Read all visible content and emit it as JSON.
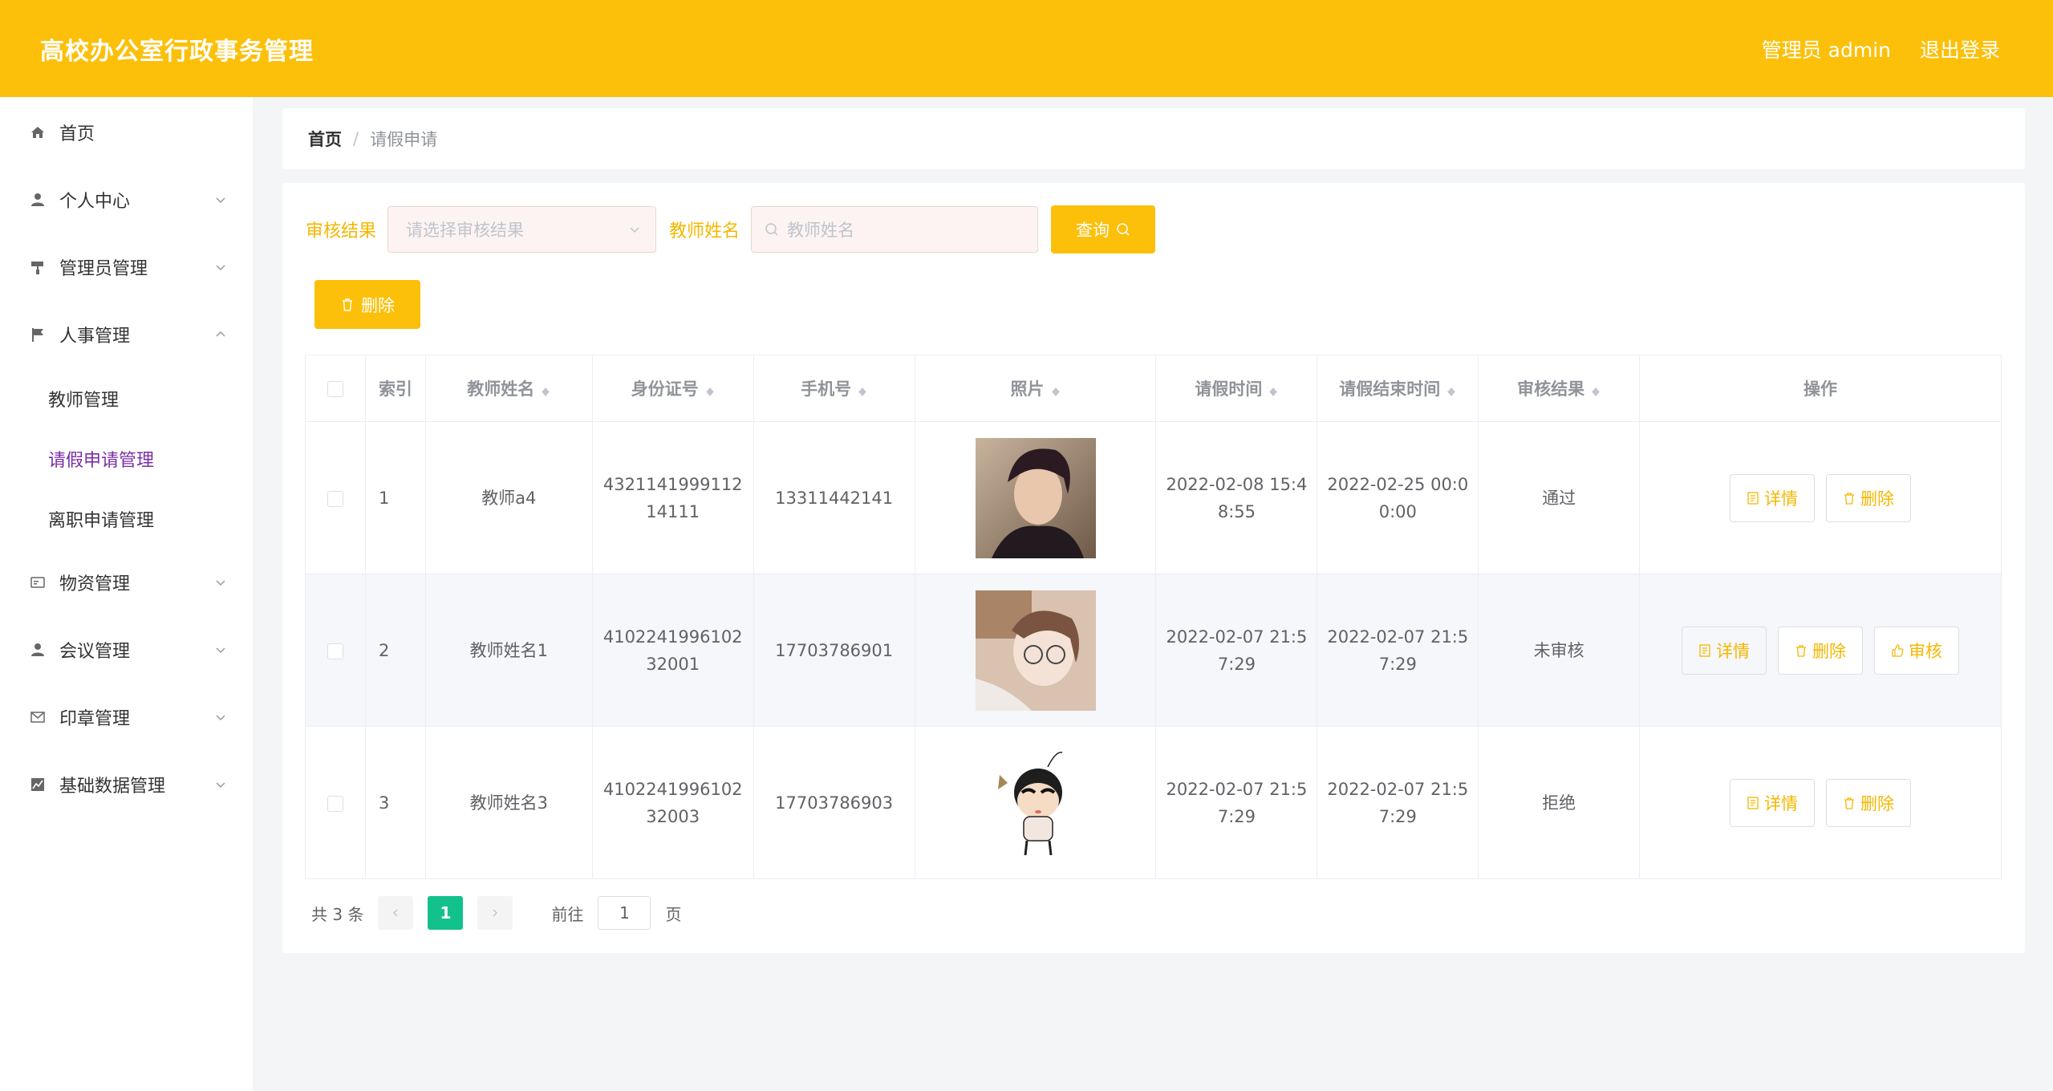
{
  "header": {
    "title": "高校办公室行政事务管理",
    "user": "管理员 admin",
    "logout": "退出登录"
  },
  "sidebar": {
    "items": [
      {
        "label": "首页",
        "icon": "home-icon"
      },
      {
        "label": "个人中心",
        "icon": "user-icon"
      },
      {
        "label": "管理员管理",
        "icon": "paint-roller-icon"
      },
      {
        "label": "人事管理",
        "icon": "flag-icon"
      },
      {
        "label": "物资管理",
        "icon": "id-card-icon"
      },
      {
        "label": "会议管理",
        "icon": "user-icon"
      },
      {
        "label": "印章管理",
        "icon": "mail-icon"
      },
      {
        "label": "基础数据管理",
        "icon": "chart-icon"
      }
    ],
    "sub_items": [
      {
        "label": "教师管理"
      },
      {
        "label": "请假申请管理"
      },
      {
        "label": "离职申请管理"
      }
    ]
  },
  "breadcrumb": {
    "home": "首页",
    "sep": "/",
    "current": "请假申请"
  },
  "filter": {
    "status_label": "审核结果",
    "status_placeholder": "请选择审核结果",
    "name_label": "教师姓名",
    "name_placeholder": "教师姓名",
    "query_button": "查询",
    "delete_button": "删除"
  },
  "table": {
    "columns": [
      "索引",
      "教师姓名",
      "身份证号",
      "手机号",
      "照片",
      "请假时间",
      "请假结束时间",
      "审核结果",
      "操作"
    ],
    "rows": [
      {
        "index": "1",
        "name": "教师a4",
        "id_line1": "4321141999112",
        "id_line2": "14111",
        "phone": "13311442141",
        "start_line1": "2022-02-08 15:4",
        "start_line2": "8:55",
        "end_line1": "2022-02-25 00:0",
        "end_line2": "0:00",
        "status": "通过",
        "detail": "详情",
        "delete": "删除"
      },
      {
        "index": "2",
        "name": "教师姓名1",
        "id_line1": "4102241996102",
        "id_line2": "32001",
        "phone": "17703786901",
        "start_line1": "2022-02-07 21:5",
        "start_line2": "7:29",
        "end_line1": "2022-02-07 21:5",
        "end_line2": "7:29",
        "status": "未审核",
        "detail": "详情",
        "delete": "删除",
        "review": "审核"
      },
      {
        "index": "3",
        "name": "教师姓名3",
        "id_line1": "4102241996102",
        "id_line2": "32003",
        "phone": "17703786903",
        "start_line1": "2022-02-07 21:5",
        "start_line2": "7:29",
        "end_line1": "2022-02-07 21:5",
        "end_line2": "7:29",
        "status": "拒绝",
        "detail": "详情",
        "delete": "删除"
      }
    ]
  },
  "pagination": {
    "total": "共 3 条",
    "current_page": "1",
    "goto_label": "前往",
    "goto_value": "1",
    "page_unit": "页"
  },
  "colors": {
    "accent": "#fcc00a",
    "active_page": "#13c18d",
    "active_menu": "#7a2ea8"
  }
}
